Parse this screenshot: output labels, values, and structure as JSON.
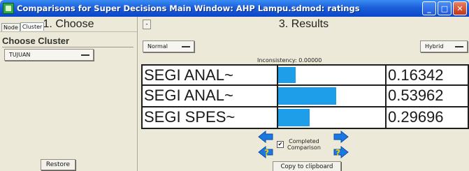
{
  "window": {
    "title": "Comparisons for Super Decisions Main Window: AHP Lampu.sdmod: ratings",
    "buttons": {
      "minimize": "_",
      "maximize": "□",
      "close": "✕"
    }
  },
  "left_panel": {
    "header": "1. Choose",
    "tabs": [
      {
        "label": "Node"
      },
      {
        "label": "Cluster",
        "active": true
      }
    ],
    "choose_cluster_label": "Choose Cluster",
    "cluster_dropdown_value": "TUJUAN",
    "restore_label": "Restore"
  },
  "right_panel": {
    "header": "3. Results",
    "collapse_label": "-",
    "mode_dropdown_value": "Normal",
    "type_dropdown_value": "Hybrid",
    "inconsistency": "Inconsistency: 0.00000",
    "results": [
      {
        "name": "SEGI ANAL~",
        "value": "0.16342",
        "priority": 0.16342
      },
      {
        "name": "SEGI ANAL~",
        "value": "0.53962",
        "priority": 0.53962
      },
      {
        "name": "SEGI SPES~",
        "value": "0.29696",
        "priority": 0.29696
      }
    ],
    "completed_checked": true,
    "completed_line1": "Completed",
    "completed_line2": "Comparison",
    "copy_label": "Copy to clipboard"
  },
  "colors": {
    "bar": "#1e9ee8",
    "titlebar": "#0a46c9"
  }
}
